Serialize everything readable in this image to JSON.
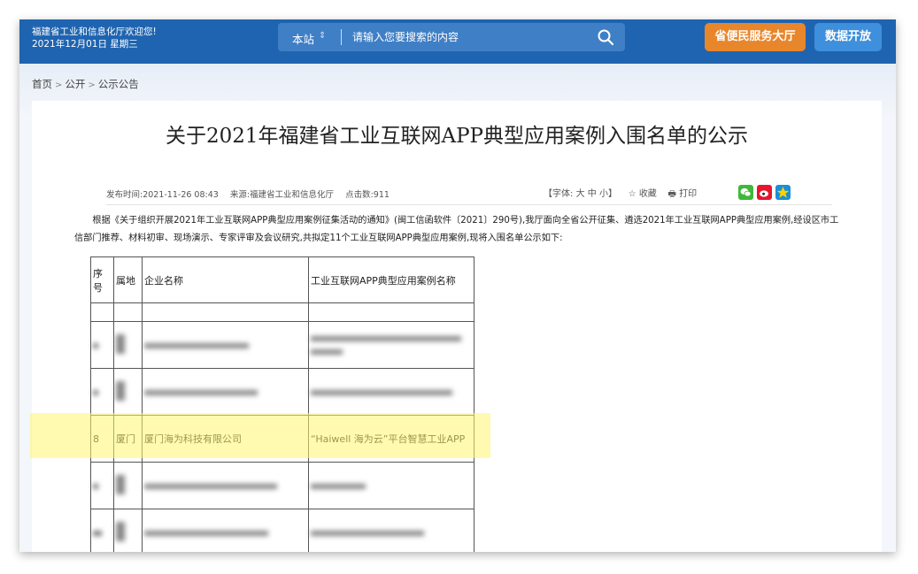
{
  "header": {
    "welcome": "福建省工业和信息化厅欢迎您!",
    "date": "2021年12月01日 星期三",
    "search": {
      "scope_label": "本站",
      "placeholder": "请输入您要搜索的内容",
      "icon": "search-icon"
    },
    "buttons": {
      "service": "省便民服务大厅",
      "data_open": "数据开放"
    },
    "colors": {
      "bar": "#1f64b0",
      "service": "#e8862c",
      "data": "#3e8fdc"
    }
  },
  "breadcrumb": [
    "首页",
    "公开",
    "公示公告"
  ],
  "article": {
    "title": "关于2021年福建省工业互联网APP典型应用案例入围名单的公示",
    "meta": {
      "published": "发布时间:2021-11-26 08:43",
      "source": "来源:福建省工业和信息化厅",
      "clicks": "点击数:911"
    },
    "tools": {
      "font_label": "【字体:",
      "font_large": "大",
      "font_medium": "中",
      "font_small": "小",
      "font_close": "】",
      "favorite": "收藏",
      "print": "打印"
    },
    "share_icons": [
      "wechat-icon",
      "weibo-icon",
      "qzone-icon"
    ],
    "paragraph": "根据《关于组织开展2021年工业互联网APP典型应用案例征集活动的通知》(闽工信函软件〔2021〕290号),我厅面向全省公开征集、遴选2021年工业互联网APP典型应用案例,经设区市工信部门推荐、材料初审、现场演示、专家评审及会议研究,共拟定11个工业互联网APP典型应用案例,现将入围名单公示如下:"
  },
  "table": {
    "headers": [
      "序号",
      "属地",
      "企业名称",
      "工业互联网APP典型应用案例名称"
    ],
    "highlight_row": {
      "no": "8",
      "location": "厦门",
      "company": "厦门海为科技有限公司",
      "app": "“Haiwell 海为云”平台智慧工业APP"
    },
    "highlight_color": "#fff56e"
  }
}
